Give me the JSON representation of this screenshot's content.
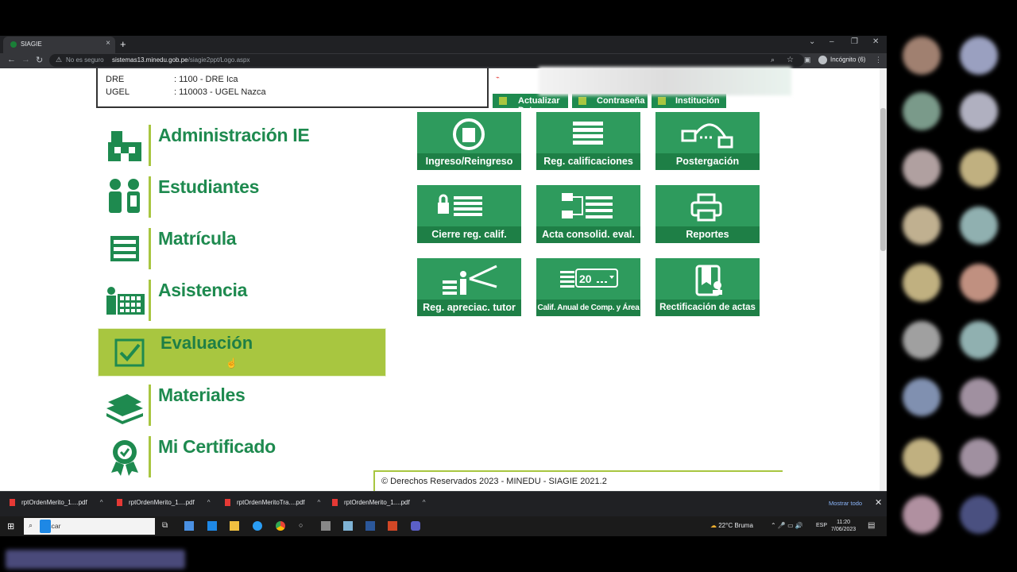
{
  "browser": {
    "tab_title": "SIAGIE",
    "security_text": "No es seguro",
    "url_domain": "sistemas13.minedu.gob.pe",
    "url_path": "/siagie2ppt/Logo.aspx",
    "incognito_label": "Incógnito (6)"
  },
  "info": {
    "dre_label": "DRE",
    "dre_value": ": 1100 - DRE Ica",
    "ugel_label": "UGEL",
    "ugel_value": ": 110003 - UGEL Nazca"
  },
  "top_buttons": [
    {
      "label": "Actualizar Datos"
    },
    {
      "label": "Contraseña"
    },
    {
      "label": "Institución"
    }
  ],
  "menu": [
    {
      "label": "Administración IE",
      "icon": "school-building-icon"
    },
    {
      "label": "Estudiantes",
      "icon": "students-icon"
    },
    {
      "label": "Matrícula",
      "icon": "enrollment-form-icon"
    },
    {
      "label": "Asistencia",
      "icon": "attendance-icon"
    },
    {
      "label": "Evaluación",
      "icon": "checkbox-icon",
      "active": true
    },
    {
      "label": "Materiales",
      "icon": "books-icon"
    },
    {
      "label": "Mi Certificado",
      "icon": "certificate-badge-icon"
    }
  ],
  "tiles": [
    {
      "label": "Ingreso/Reingreso"
    },
    {
      "label": "Reg. calificaciones"
    },
    {
      "label": "Postergación"
    },
    {
      "label": "Cierre reg. calif."
    },
    {
      "label": "Acta consolid. eval."
    },
    {
      "label": "Reportes"
    },
    {
      "label": "Reg. apreciac. tutor"
    },
    {
      "label": "Calif. Anual de Comp. y Área"
    },
    {
      "label": "Rectificación de actas"
    }
  ],
  "tile_icon_text": "20",
  "footer": "© Derechos Reservados 2023 - MINEDU - SIAGIE 2021.2",
  "downloads": [
    {
      "name": "rptOrdenMerito_1....pdf"
    },
    {
      "name": "rptOrdenMerito_1....pdf"
    },
    {
      "name": "rptOrdenMeritoTra....pdf"
    },
    {
      "name": "rptOrdenMerito_1....pdf"
    }
  ],
  "show_all": "Mostrar todo",
  "taskbar": {
    "search_placeholder": "Buscar",
    "weather": "22°C  Bruma",
    "lang": "ESP",
    "time": "11:20",
    "date": "7/06/2023"
  },
  "colors": {
    "green": "#2e9b5d",
    "dark_green": "#1e7f46",
    "lime": "#a8c640"
  }
}
